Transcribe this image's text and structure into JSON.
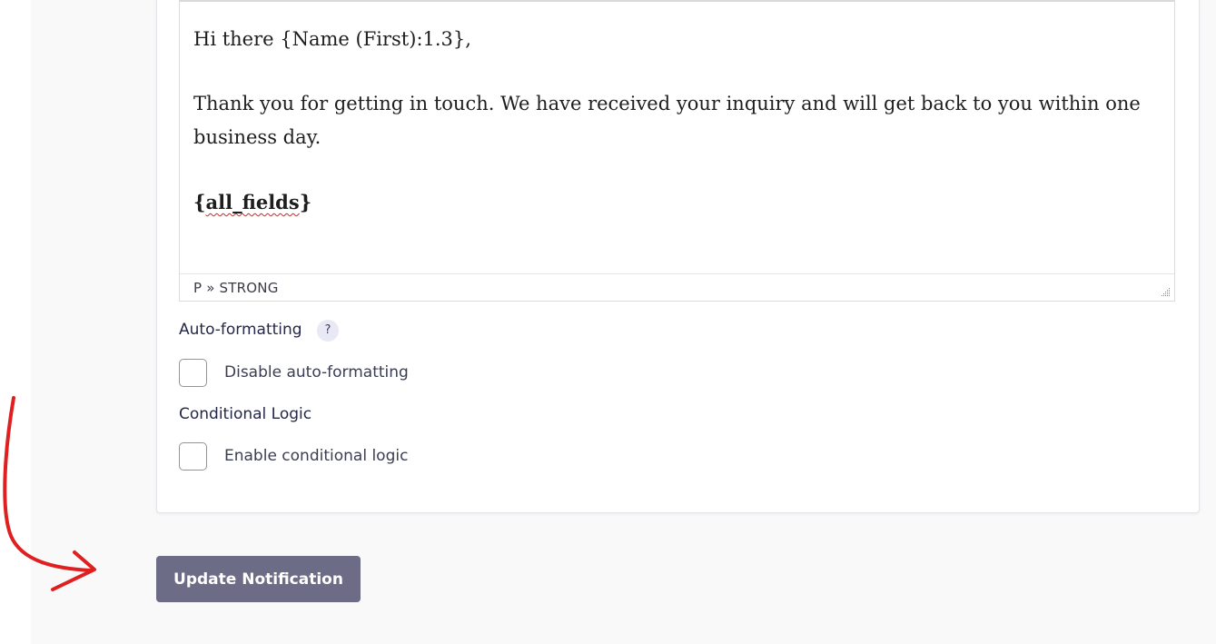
{
  "editor": {
    "greeting": "Hi there {Name (First):1.3},",
    "message": "Thank you for getting in touch. We have received your inquiry and will get back to you within one business day.",
    "merge_tag": "{all_fields}",
    "status_path": "P » STRONG"
  },
  "auto_formatting": {
    "label": "Auto-formatting",
    "help_glyph": "?",
    "help_icon": "question-icon",
    "checkbox_label": "Disable auto-formatting",
    "checked": false
  },
  "conditional_logic": {
    "label": "Conditional Logic",
    "checkbox_label": "Enable conditional logic",
    "checked": false
  },
  "actions": {
    "update_label": "Update Notification",
    "update_color": "#6c6c87"
  },
  "annotation": {
    "icon": "red-hand-drawn-arrow-icon",
    "color": "#e02020"
  }
}
